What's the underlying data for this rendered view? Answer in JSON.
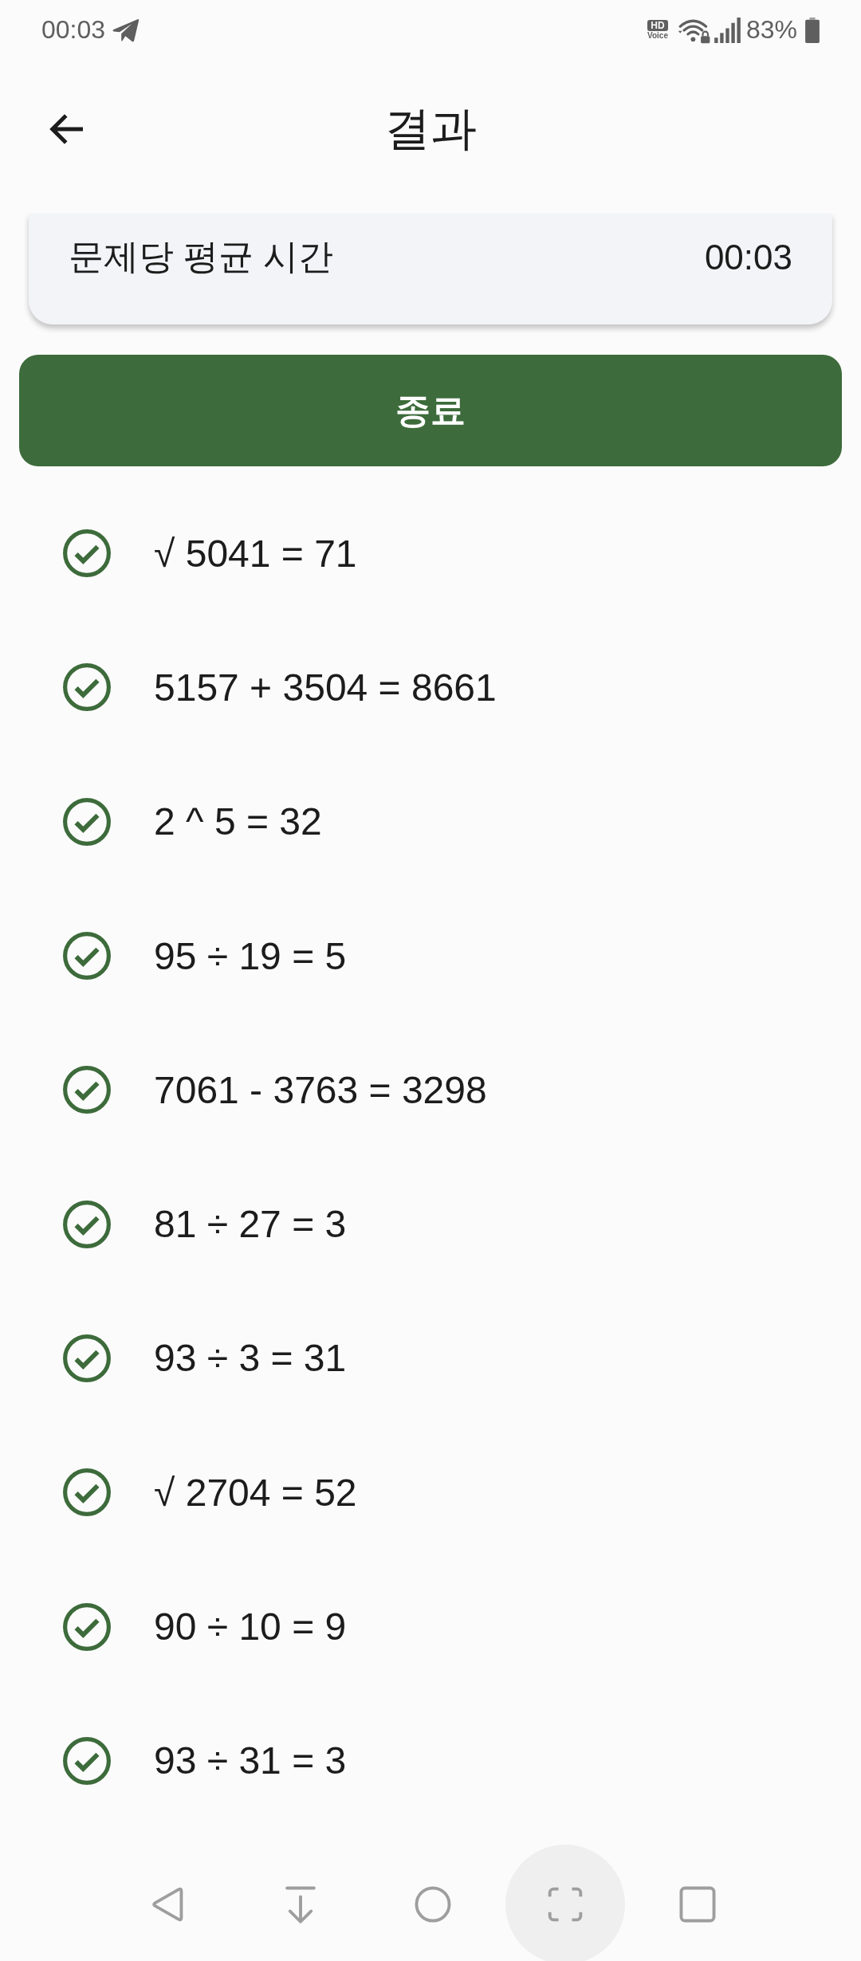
{
  "status_bar": {
    "time": "00:03",
    "hd_label": "HD",
    "voice_label": "Voice",
    "battery": "83%"
  },
  "header": {
    "title": "결과"
  },
  "summary_card": {
    "label": "문제당 평균 시간",
    "value": "00:03"
  },
  "finish_button": {
    "label": "종료"
  },
  "results": [
    {
      "equation": "√ 5041 = 71",
      "correct": true
    },
    {
      "equation": "5157 + 3504 = 8661",
      "correct": true
    },
    {
      "equation": "2 ^ 5 = 32",
      "correct": true
    },
    {
      "equation": "95 ÷ 19 = 5",
      "correct": true
    },
    {
      "equation": "7061 - 3763 = 3298",
      "correct": true
    },
    {
      "equation": "81 ÷ 27 = 3",
      "correct": true
    },
    {
      "equation": "93 ÷ 3 = 31",
      "correct": true
    },
    {
      "equation": "√ 2704 = 52",
      "correct": true
    },
    {
      "equation": "90 ÷ 10 = 9",
      "correct": true
    },
    {
      "equation": "93 ÷ 31 = 3",
      "correct": true
    }
  ],
  "nav_bar": [
    {
      "kind": "back",
      "selected": false
    },
    {
      "kind": "pin",
      "selected": false
    },
    {
      "kind": "home",
      "selected": false
    },
    {
      "kind": "capture",
      "selected": true
    },
    {
      "kind": "recents",
      "selected": false
    }
  ]
}
